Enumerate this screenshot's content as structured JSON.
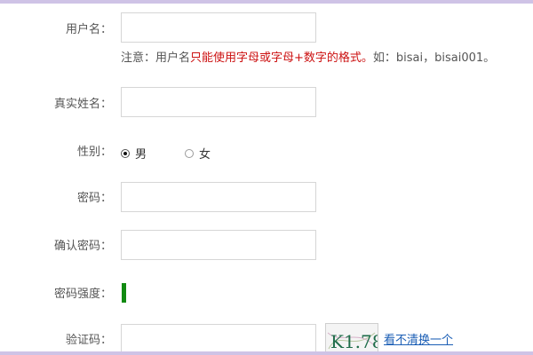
{
  "form": {
    "username_label": "用户名：",
    "username_value": "",
    "hint_prefix": "注意：用户名",
    "hint_red": "只能使用字母或字母+数字的格式。",
    "hint_suffix": "如：bisai，bisai001。",
    "realname_label": "真实姓名：",
    "realname_value": "",
    "gender_label": "性别：",
    "gender_options": [
      "男",
      "女"
    ],
    "gender_selected": "男",
    "password_label": "密码：",
    "confirm_label": "确认密码：",
    "strength_label": "密码强度：",
    "strength_level": 0.1,
    "strength_color": "#118a11",
    "captcha_label": "验证码：",
    "captcha_value": "",
    "captcha_text": "K1.78",
    "refresh_label": "看不清换一个"
  },
  "colors": {
    "frame": "#cfc3e6",
    "hint_red": "#cc1111",
    "link": "#1b5eb5"
  }
}
